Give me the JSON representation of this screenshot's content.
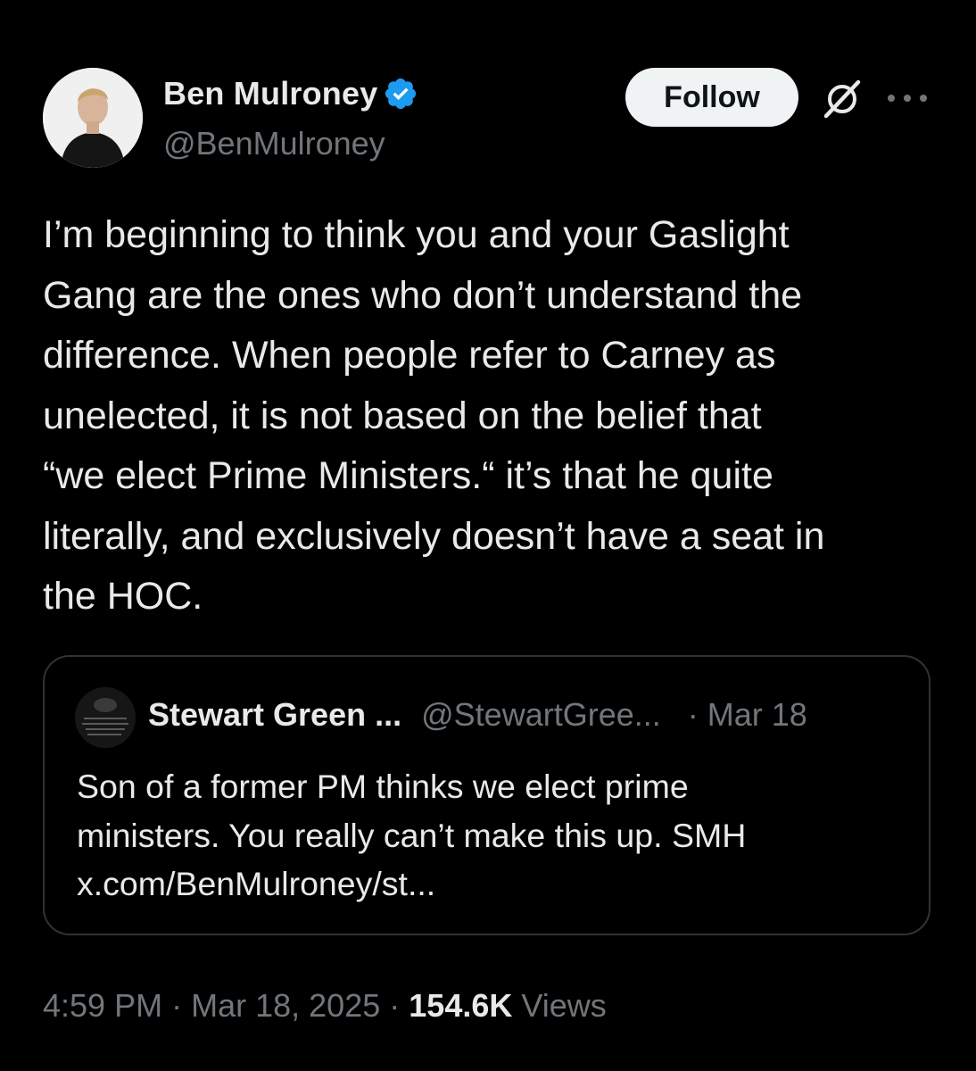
{
  "author": {
    "display_name": "Ben Mulroney",
    "handle": "@BenMulroney",
    "verified_icon": "verified-badge-icon",
    "verified_color": "#1d9bf0"
  },
  "actions": {
    "follow_label": "Follow",
    "grok_icon": "grok-icon",
    "more_icon": "more-icon"
  },
  "tweet": {
    "text": "I’m beginning to think you and your Gaslight\nGang are the ones who don’t understand the\ndifference. When people refer to Carney as\nunelected, it is not based on the belief that\n“we elect Prime Ministers.“ it’s that he quite\nliterally, and exclusively doesn’t have a seat in\nthe HOC."
  },
  "quote": {
    "display_name": "Stewart Green ...",
    "handle": "@StewartGree...",
    "separator": "·",
    "date": "Mar 18",
    "text": "Son of a former PM thinks we elect prime\nministers. You really can’t make this up. SMH\nx.com/BenMulroney/st..."
  },
  "meta": {
    "time": "4:59 PM",
    "separator": "·",
    "date": "Mar 18, 2025",
    "views_count": "154.6K",
    "views_label": "Views"
  },
  "colors": {
    "background": "#000000",
    "text_primary": "#e7e9ea",
    "text_secondary": "#71767b",
    "border": "#2f3336",
    "follow_bg": "#eff3f4"
  }
}
